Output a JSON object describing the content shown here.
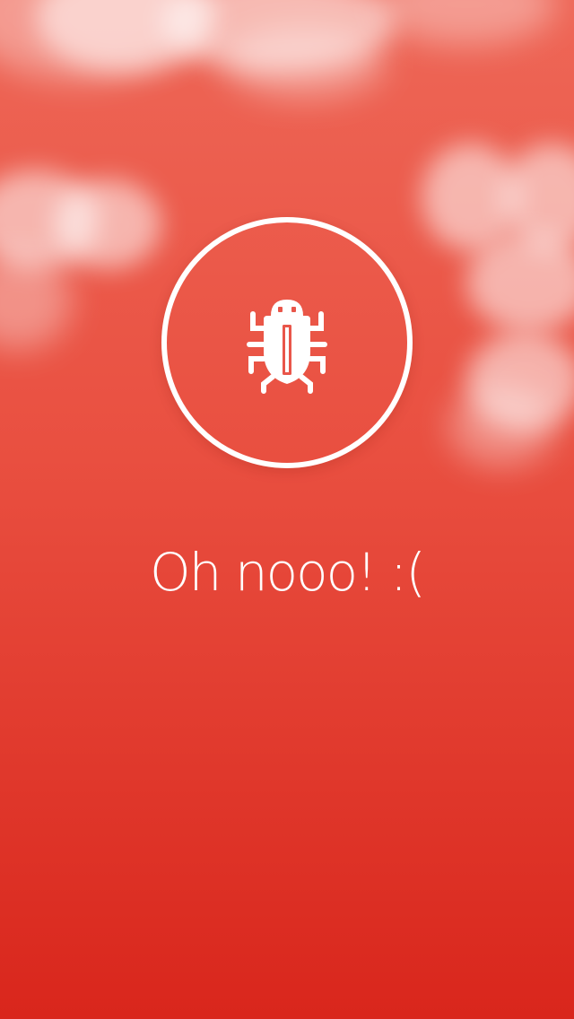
{
  "screen": {
    "message": "Oh nooo! :(",
    "icon": "bug-icon",
    "colors": {
      "background_top": "#ee6757",
      "background_bottom": "#d9261c",
      "foreground": "#ffffff"
    }
  }
}
